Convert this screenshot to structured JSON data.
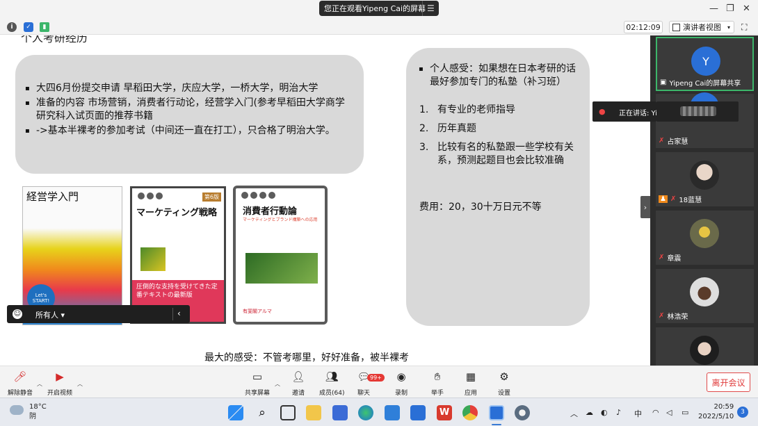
{
  "window": {
    "share_banner": "您正在观看Yipeng Cai的屏幕",
    "menu_icon": "menu-icon",
    "minimize": "—",
    "restore": "❐",
    "close": "✕"
  },
  "toolbar": {
    "timer": "02:12:09",
    "view_mode": "演讲者视图",
    "caret": "▾"
  },
  "slide": {
    "heading": "个人考研经历",
    "left_bullets": [
      "大四6月份提交申请 早稻田大学，庆应大学，一桥大学，明治大学",
      "准备的内容 市场营销，消费者行动论，经营学入门(参考早稻田大学商学研究科入试页面的推荐书籍",
      "->基本半裸考的参加考试（中间还一直在打工），只合格了明治大学。"
    ],
    "right_bullet": "个人感受：如果想在日本考研的话最好参加专门的私塾（补习班）",
    "right_numbered": [
      {
        "n": "1.",
        "text": "有专业的老师指导"
      },
      {
        "n": "2.",
        "text": "历年真题"
      },
      {
        "n": "3.",
        "text": "比较有名的私塾跟一些学校有关系，预测起题目也会比较准确"
      }
    ],
    "cost": "费用：20，30十万日元不等",
    "conclusion": "最大的感受：不管考哪里，好好准备，被半裸考",
    "books": [
      {
        "title": "経営学入門",
        "badge": "Let's START!"
      },
      {
        "title": "マーケティング戦略",
        "edition": "第6版",
        "blurb": "圧倒的な支持を受けてきた定番テキストの最新版"
      },
      {
        "title": "消費者行動論",
        "subtitle": "マーケティングとブランド構築への応用",
        "publisher": "有斐閣アルマ"
      }
    ]
  },
  "chat": {
    "recipient": "所有人 ▾",
    "collapse": "‹"
  },
  "speaking": {
    "label": "正在讲话: Yipeng Cai;"
  },
  "gallery": {
    "tiles": [
      {
        "name": "Yipeng Cai的屏幕共享",
        "initial": "Y"
      },
      {
        "name": "占家慧"
      },
      {
        "name": "18蓝慧"
      },
      {
        "name": "章震"
      },
      {
        "name": "林浩荣"
      }
    ],
    "handle": "›"
  },
  "controls": {
    "mute": "解除静音",
    "video": "开启视频",
    "share": "共享屏幕",
    "invite": "邀请",
    "members": "成员(64)",
    "chat": "聊天",
    "chat_badge": "99+",
    "record": "录制",
    "raise_hand": "举手",
    "apps": "应用",
    "settings": "设置",
    "leave": "离开会议"
  },
  "taskbar": {
    "temperature": "18°C",
    "condition": "阴",
    "ime": "中",
    "time": "20:59",
    "date": "2022/5/10",
    "notifications": "3"
  },
  "colors": {
    "box_gray": "#d9d9d9",
    "gallery_bg": "#2d2d2d",
    "accent_blue": "#2a6fd6",
    "leave_red": "#e03a3a",
    "speaker_green": "#3cb66a"
  }
}
